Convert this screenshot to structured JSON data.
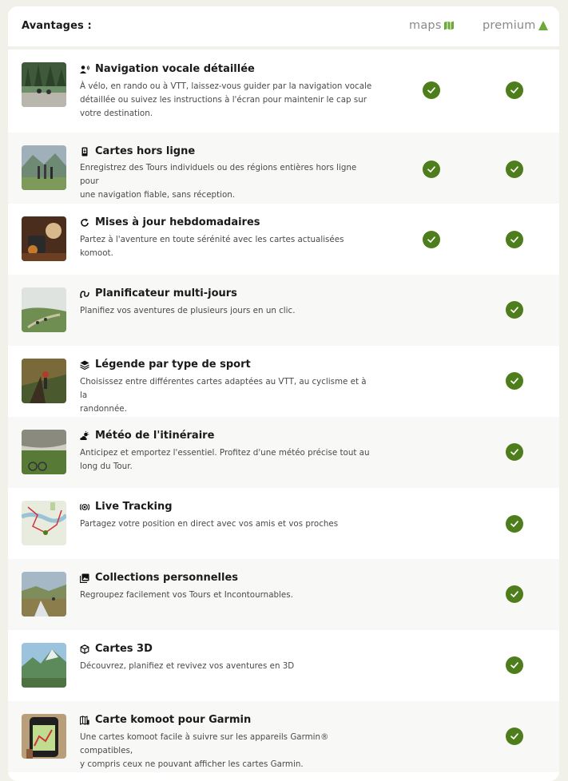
{
  "header": {
    "title": "Avantages :",
    "plans": [
      "maps",
      "premium"
    ]
  },
  "colors": {
    "accent": "#4e7d1b",
    "maps_icon": "#6fa83a",
    "premium_icon": "#6fa83a"
  },
  "features": [
    {
      "title": "Navigation vocale détaillée",
      "icon": "voice-person-icon",
      "desc": [
        "À vélo, en rando ou à VTT, laissez-vous guider par la navigation vocale",
        "détaillée ou suivez les instructions à l'écran pour maintenir le cap sur",
        "votre destination."
      ],
      "maps": true,
      "premium": true
    },
    {
      "title": "Cartes hors ligne",
      "icon": "phone-offline-icon",
      "desc": [
        "Enregistrez des Tours individuels ou des régions entières hors ligne pour",
        "une navigation fiable, sans réception."
      ],
      "maps": true,
      "premium": true
    },
    {
      "title": "Mises à jour hebdomadaires",
      "icon": "refresh-icon",
      "desc": [
        "Partez à l'aventure en toute sérénité avec les cartes actualisées komoot."
      ],
      "maps": true,
      "premium": true
    },
    {
      "title": "Planificateur multi-jours",
      "icon": "route-icon",
      "desc": [
        "Planifiez vos aventures de plusieurs jours en un clic."
      ],
      "maps": false,
      "premium": true
    },
    {
      "title": "Légende par type de sport",
      "icon": "layers-icon",
      "desc": [
        "Choisissez entre différentes cartes adaptées au VTT, au cyclisme et à la",
        "randonnée."
      ],
      "maps": false,
      "premium": true
    },
    {
      "title": "Météo de l'itinéraire",
      "icon": "weather-icon",
      "desc": [
        "Anticipez et emportez l'essentiel. Profitez d'une météo précise tout au",
        "long du Tour."
      ],
      "maps": false,
      "premium": true
    },
    {
      "title": "Live Tracking",
      "icon": "broadcast-icon",
      "desc": [
        "Partagez votre position en direct avec vos amis et vos proches"
      ],
      "maps": false,
      "premium": true
    },
    {
      "title": "Collections personnelles",
      "icon": "collection-icon",
      "desc": [
        "Regroupez facilement vos Tours et Incontournables."
      ],
      "maps": false,
      "premium": true
    },
    {
      "title": "Cartes 3D",
      "icon": "cube-icon",
      "desc": [
        "Découvrez, planifiez et revivez vos aventures en 3D"
      ],
      "maps": false,
      "premium": true
    },
    {
      "title": "Carte komoot pour Garmin",
      "icon": "map-device-icon",
      "desc": [
        "Une cartes komoot facile à suivre sur les appareils Garmin® compatibles,",
        "y compris ceux ne pouvant afficher les cartes Garmin."
      ],
      "maps": false,
      "premium": true
    }
  ]
}
